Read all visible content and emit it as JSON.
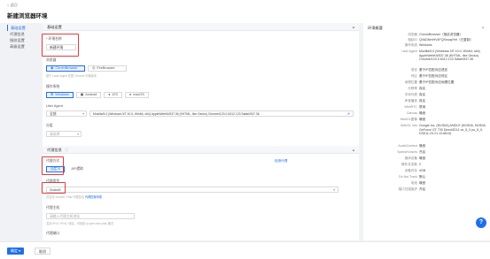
{
  "header": {
    "back": "< 返回",
    "title": "新建浏览器环境"
  },
  "sidebar": {
    "items": [
      {
        "label": "基础设置",
        "active": true
      },
      {
        "label": "代理信息",
        "active": false
      },
      {
        "label": "指纹设置",
        "active": false
      },
      {
        "label": "高级设置",
        "active": false
      }
    ]
  },
  "basic": {
    "header": "基础设置",
    "name_label": "* 环境名称",
    "name_value": "新建环境",
    "browser_label": "浏览器",
    "browser_chrome": "ChromBrowser",
    "browser_firefox": "FireBrowser",
    "browser_hint": "基于 Lwan Agent 匹配 Chrome 内核版本",
    "os_label": "操作系统",
    "os_options": [
      "Windows",
      "Android",
      "iOS",
      "macOS"
    ],
    "ua_label": "User Agent",
    "ua_select": "全部",
    "ua_value": "Mozilla/5.0 (Windows NT 10.0; Win64; x64) AppleWebKit/537.36 (KHTML, like Gecko) Chrome/123.0.6312.123 Safari/537.36",
    "group_label": "分组",
    "group_placeholder": "请选择"
  },
  "proxy": {
    "header": "代理信息",
    "method_label": "代理方式",
    "method_custom": "自定义",
    "method_api": "API提取",
    "type_label": "代理类型",
    "type_value": "Socks5",
    "check_link": "检测代理",
    "type_hint": "仅支持 Socks5 / Http 代理协议",
    "type_hint_link": "代理配置帮助",
    "host_label": "代理主机",
    "host_placeholder": "请输入代理主机地址",
    "host_hint": "支持 IPv4 / IPv6 / 域名，可粘贴 ip:port:user:pass 格式",
    "port_label": "代理端口"
  },
  "summary": {
    "title": "环境概要",
    "close": "✕",
    "rows": [
      {
        "k": "浏览器",
        "v": "ChromBrowser（指纹浏览器）"
      },
      {
        "k": "指纹ID",
        "v": "QVADNmHV4FQXeuapYet（已复制）"
      },
      {
        "k": "操作系统",
        "v": "Windows"
      },
      {
        "k": "User Agent",
        "v": "Mozilla/5.0 (Windows NT 10.0; Win64; x64) AppleWebKit/537.36 (KHTML, like Gecko) Chrome/123.0.6312.123 Safari/537.36"
      },
      {
        "k": "语言",
        "v": "基于IP匹配对应语言"
      },
      {
        "k": "时区",
        "v": "基于IP匹配对应时区"
      },
      {
        "k": "地理位置",
        "v": "基于IP匹配对应地理位置"
      },
      {
        "k": "分辨率",
        "v": "真实"
      },
      {
        "k": "字体列表",
        "v": "真实"
      },
      {
        "k": "声音播放",
        "v": "真实"
      },
      {
        "k": "WebRTC",
        "v": "禁用"
      },
      {
        "k": "Canvas",
        "v": "噪音"
      },
      {
        "k": "WebGL图像",
        "v": "噪音"
      },
      {
        "k": "WebGL Info",
        "v": "Google Inc. (NVIDIA) ANGLE (NVIDIA, NVIDIA GeForce GT 730 Direct3D11 vs_5_0 ps_5_0, D3D11-23.21.13.8813)"
      },
      {
        "k": "AudioContext",
        "v": "噪音"
      },
      {
        "k": "SpeechVoices",
        "v": "开启"
      },
      {
        "k": "媒体设备",
        "v": "噪音"
      },
      {
        "k": "硬件并发数",
        "v": "2"
      },
      {
        "k": "设备内存",
        "v": "4GB"
      },
      {
        "k": "Do Not Track",
        "v": "默认"
      },
      {
        "k": "电池",
        "v": "噪音"
      },
      {
        "k": "端口扫描保护",
        "v": "开启"
      }
    ]
  },
  "footer": {
    "confirm": "确定",
    "cancel": "取消"
  },
  "help": "?"
}
